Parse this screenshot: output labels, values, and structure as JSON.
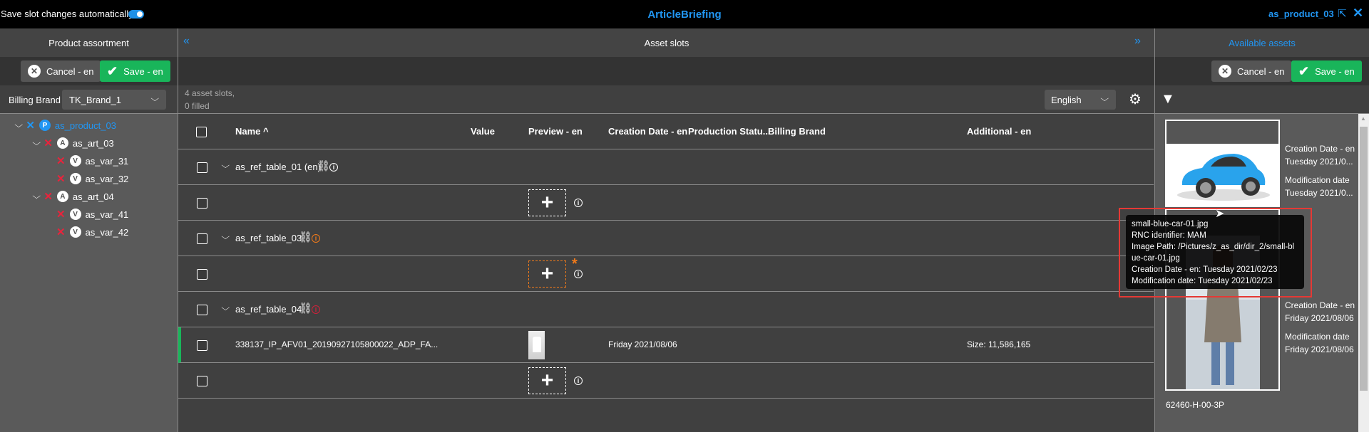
{
  "topbar": {
    "auto_save_label": "Save slot changes automatically",
    "auto_save_on": true,
    "app_title": "ArticleBriefing",
    "product_link": "as_product_03"
  },
  "left": {
    "title": "Product assortment",
    "cancel_label": "Cancel - en",
    "save_label": "Save - en",
    "billing_brand_label": "Billing Brand",
    "billing_brand_value": "TK_Brand_1",
    "tree": [
      {
        "label": "as_product_03",
        "badge": "P",
        "level": 0,
        "expandable": true,
        "active": true
      },
      {
        "label": "as_art_03",
        "badge": "A",
        "level": 1,
        "expandable": true
      },
      {
        "label": "as_var_31",
        "badge": "V",
        "level": 2
      },
      {
        "label": "as_var_32",
        "badge": "V",
        "level": 2
      },
      {
        "label": "as_art_04",
        "badge": "A",
        "level": 1,
        "expandable": true
      },
      {
        "label": "as_var_41",
        "badge": "V",
        "level": 2
      },
      {
        "label": "as_var_42",
        "badge": "V",
        "level": 2
      }
    ]
  },
  "middle": {
    "title": "Asset slots",
    "collapse_left": "«",
    "collapse_right": "»",
    "summary_line1": "4 asset slots,",
    "summary_line2": "0 filled",
    "language": "English",
    "columns": [
      "Name ^",
      "Value",
      "Preview - en",
      "Creation Date - en",
      "Production Statu...",
      "Billing Brand",
      "Additional - en"
    ],
    "groups": [
      {
        "label": "as_ref_table_01 (en)",
        "info_color": "#ffffff"
      },
      {
        "label": "as_ref_table_03",
        "info_color": "#f07a1a"
      },
      {
        "label": "as_ref_table_04",
        "info_color": "#d0213a"
      }
    ],
    "asset_row": {
      "name": "338137_IP_AFV01_20190927105800022_ADP_FA...",
      "creation_date": "Friday 2021/08/06",
      "additional": "Size: 11,586,165"
    },
    "required_marker": "*",
    "add_symbol": "+"
  },
  "right": {
    "title": "Available assets",
    "cancel_label": "Cancel - en",
    "save_label": "Save - en",
    "cards": [
      {
        "creation_label": "Creation Date - en",
        "creation_value": "Tuesday 2021/0...",
        "modification_label": "Modification date",
        "modification_value": "Tuesday 2021/0..."
      },
      {
        "creation_label": "Creation Date - en",
        "creation_value": "Friday 2021/08/06",
        "modification_label": "Modification date",
        "modification_value": "Friday 2021/08/06",
        "name": "62460-H-00-3P"
      }
    ],
    "tooltip": {
      "line1": "small-blue-car-01.jpg",
      "line2": "RNC identifier: MAM",
      "line3": "Image Path: /Pictures/z_as_dir/dir_2/small-blue-car-01.jpg",
      "line4": "Creation Date - en: Tuesday 2021/02/23",
      "line5": "Modification date: Tuesday 2021/02/23"
    }
  },
  "colors": {
    "accent": "#2196f3",
    "save": "#19b55a",
    "error": "#e8243c",
    "warning": "#f07a1a",
    "highlight_frame": "#e53935"
  }
}
